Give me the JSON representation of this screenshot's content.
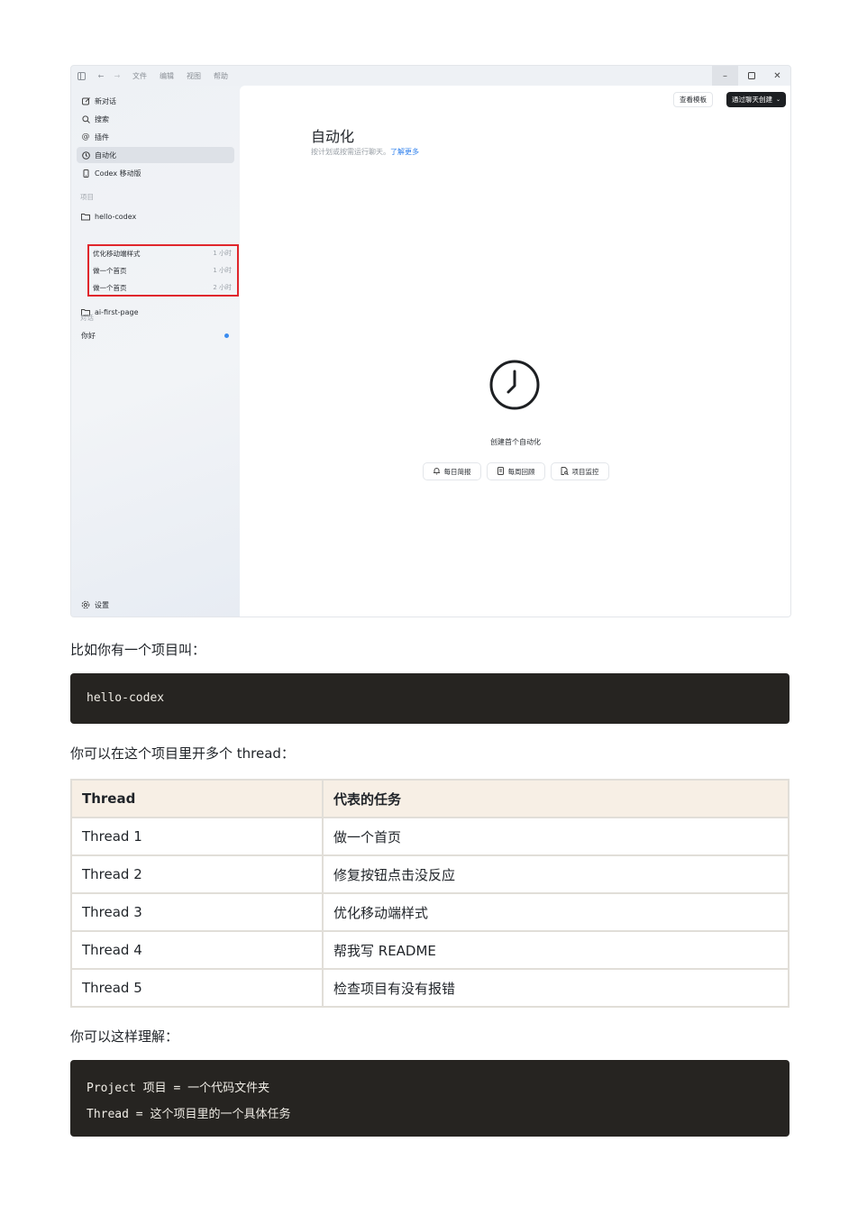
{
  "app": {
    "menu": [
      "文件",
      "编辑",
      "视图",
      "帮助"
    ],
    "sidebar": {
      "nav": [
        "新对话",
        "搜索",
        "插件",
        "自动化",
        "Codex 移动版"
      ],
      "projects_label": "项目",
      "project_1": "hello-codex",
      "threads": [
        {
          "title": "优化移动端样式",
          "time": "1 小时"
        },
        {
          "title": "做一个首页",
          "time": "1 小时"
        },
        {
          "title": "做一个首页",
          "time": "2 小时"
        }
      ],
      "project_2": "ai-first-page",
      "chats_label": "对话",
      "chat_1": "你好",
      "settings": "设置"
    },
    "main": {
      "view_templates": "查看模板",
      "create_via_chat": "通过聊天创建",
      "title": "自动化",
      "subtitle": "按计划或按需运行聊天。",
      "learn_more": "了解更多",
      "empty_label": "创建首个自动化",
      "chips": [
        "每日简报",
        "每周回顾",
        "项目监控"
      ]
    },
    "accent_color": "#2f80ed",
    "highlight_color": "#e0262c"
  },
  "doc": {
    "para1": "比如你有一个项目叫：",
    "code1": "hello-codex",
    "para2": "你可以在这个项目里开多个 thread：",
    "table": {
      "headers": [
        "Thread",
        "代表的任务"
      ],
      "rows": [
        [
          "Thread 1",
          "做一个首页"
        ],
        [
          "Thread 2",
          "修复按钮点击没反应"
        ],
        [
          "Thread 3",
          "优化移动端样式"
        ],
        [
          "Thread 4",
          "帮我写 README"
        ],
        [
          "Thread 5",
          "检查项目有没有报错"
        ]
      ]
    },
    "para3": "你可以这样理解：",
    "code2": [
      "Project 项目 = 一个代码文件夹",
      "Thread = 这个项目里的一个具体任务"
    ]
  }
}
